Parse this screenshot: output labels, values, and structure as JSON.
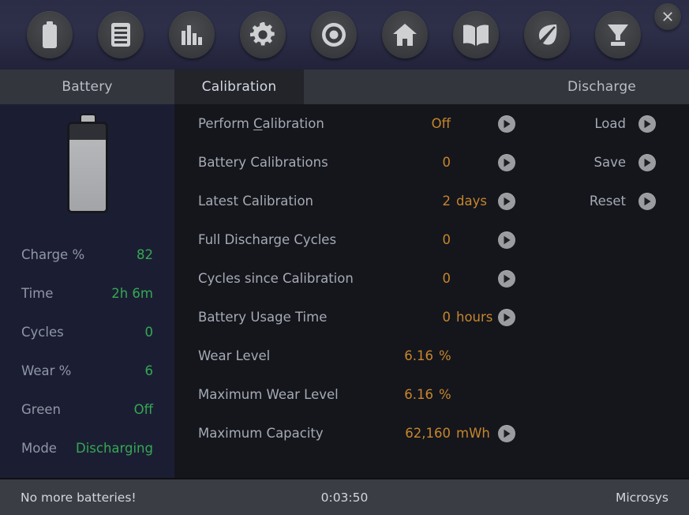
{
  "window": {
    "close_label": "×"
  },
  "toolbar": {
    "buttons": [
      {
        "name": "battery-icon",
        "title": "Battery"
      },
      {
        "name": "list-icon",
        "title": "Details"
      },
      {
        "name": "bar-chart-icon",
        "title": "Statistics"
      },
      {
        "name": "gear-icon",
        "title": "Settings"
      },
      {
        "name": "target-icon",
        "title": "Monitor"
      },
      {
        "name": "home-icon",
        "title": "Home"
      },
      {
        "name": "book-icon",
        "title": "Help"
      },
      {
        "name": "leaf-icon",
        "title": "Green"
      },
      {
        "name": "funnel-icon",
        "title": "Discharge"
      }
    ]
  },
  "tabs": [
    {
      "label": "Battery",
      "active": false
    },
    {
      "label": "Calibration",
      "active": true
    },
    {
      "label": "Discharge",
      "active": false
    }
  ],
  "sidebar": {
    "battery_gauge": {
      "fill_percent": 82
    },
    "rows": [
      {
        "label": "Charge %",
        "value": "82"
      },
      {
        "label": "Time",
        "value": "2h 6m"
      },
      {
        "label": "Cycles",
        "value": "0"
      },
      {
        "label": "Wear %",
        "value": "6"
      },
      {
        "label": "Green",
        "value": "Off"
      },
      {
        "label": "Mode",
        "value": "Discharging"
      }
    ],
    "value_color": "#35a852"
  },
  "main": {
    "value_color": "#c8852b",
    "rows": [
      {
        "label": "Perform ",
        "accel": "C",
        "label_rest": "alibration",
        "value": "Off",
        "unit": "",
        "has_button": true
      },
      {
        "label": "Battery Calibrations",
        "accel": "",
        "label_rest": "",
        "value": "0",
        "unit": "",
        "has_button": true
      },
      {
        "label": "Latest Calibration",
        "accel": "",
        "label_rest": "",
        "value": "2",
        "unit": "days",
        "has_button": true
      },
      {
        "label": "Full Discharge Cycles",
        "accel": "",
        "label_rest": "",
        "value": "0",
        "unit": "",
        "has_button": true
      },
      {
        "label": "Cycles since Calibration",
        "accel": "",
        "label_rest": "",
        "value": "0",
        "unit": "",
        "has_button": true
      },
      {
        "label": "Battery Usage Time",
        "accel": "",
        "label_rest": "",
        "value": "0",
        "unit": "hours",
        "has_button": true
      },
      {
        "label": "Wear Level",
        "accel": "",
        "label_rest": "",
        "value": "6.16",
        "unit": "%",
        "has_button": false
      },
      {
        "label": "Maximum Wear Level",
        "accel": "",
        "label_rest": "",
        "value": "6.16",
        "unit": "%",
        "has_button": false
      },
      {
        "label": "Maximum Capacity",
        "accel": "",
        "label_rest": "",
        "value": "62,160",
        "unit": "mWh",
        "has_button": true
      }
    ],
    "actions": [
      {
        "label": "Load"
      },
      {
        "label": "Save"
      },
      {
        "label": "Reset"
      }
    ]
  },
  "statusbar": {
    "left": "No more batteries!",
    "center": "0:03:50",
    "right": "Microsys"
  }
}
